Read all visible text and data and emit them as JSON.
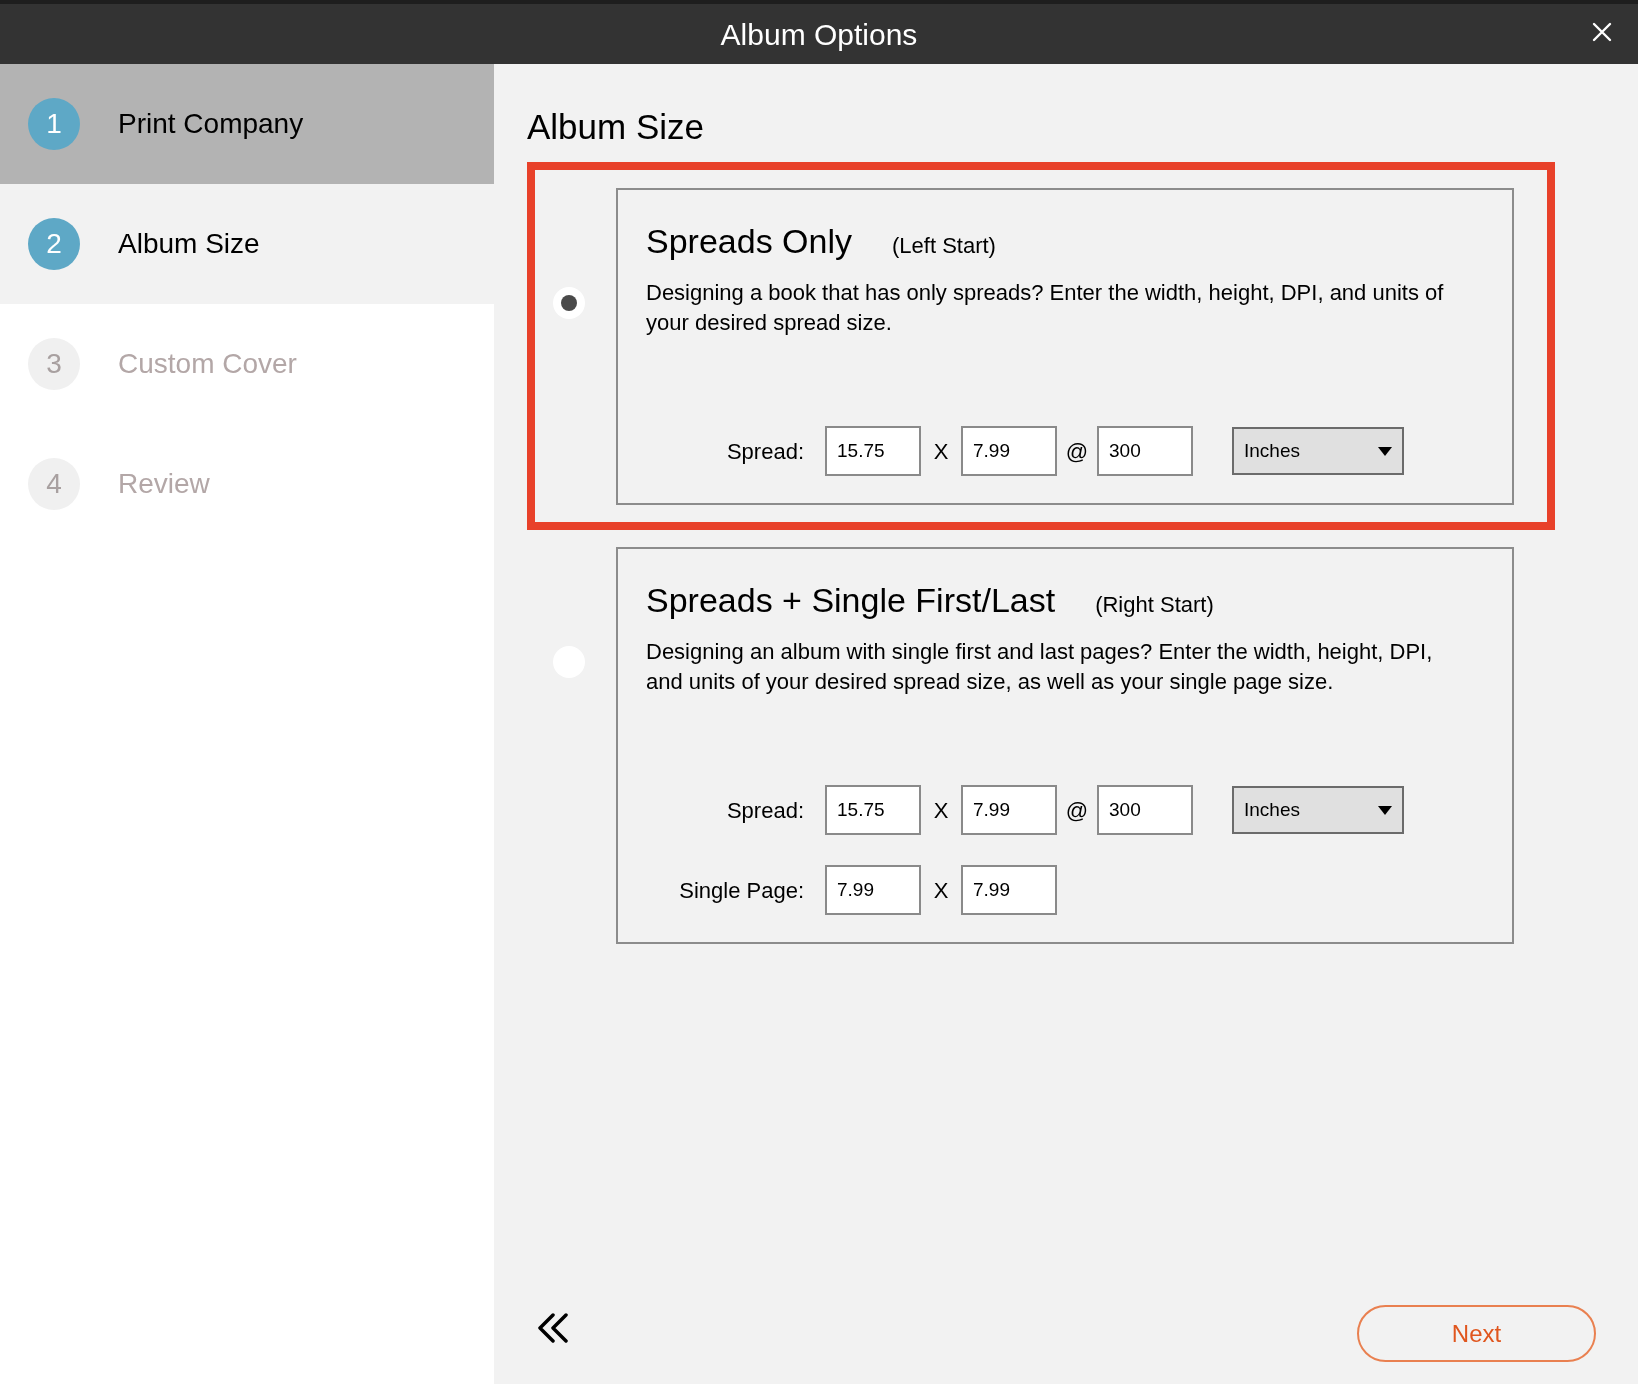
{
  "window": {
    "title": "Album Options"
  },
  "steps": [
    {
      "number": "1",
      "label": "Print Company",
      "completed": true,
      "selected": false,
      "disabled": false
    },
    {
      "number": "2",
      "label": "Album Size",
      "completed": false,
      "selected": true,
      "disabled": false
    },
    {
      "number": "3",
      "label": "Custom Cover",
      "completed": false,
      "selected": false,
      "disabled": true
    },
    {
      "number": "4",
      "label": "Review",
      "completed": false,
      "selected": false,
      "disabled": true
    }
  ],
  "heading": "Album Size",
  "options": [
    {
      "title": "Spreads Only",
      "subtitle": "(Left Start)",
      "selected": true,
      "description": "Designing a book that has only spreads? Enter the width, height, DPI, and units of your desired spread size.",
      "rows": [
        {
          "label": "Spread:",
          "items": [
            {
              "kind": "field",
              "value": "15.75"
            },
            {
              "kind": "sep",
              "text": "X"
            },
            {
              "kind": "field",
              "value": "7.99"
            },
            {
              "kind": "sep",
              "text": "@"
            },
            {
              "kind": "field",
              "value": "300"
            },
            {
              "kind": "select",
              "value": "Inches"
            }
          ]
        }
      ]
    },
    {
      "title": "Spreads + Single First/Last",
      "subtitle": "(Right Start)",
      "selected": false,
      "description": "Designing an album with single first and last pages? Enter the width, height, DPI, and units of your desired spread size, as well as your single page size.",
      "rows": [
        {
          "label": "Spread:",
          "items": [
            {
              "kind": "field",
              "value": "15.75"
            },
            {
              "kind": "sep",
              "text": "X"
            },
            {
              "kind": "field",
              "value": "7.99"
            },
            {
              "kind": "sep",
              "text": "@"
            },
            {
              "kind": "field",
              "value": "300"
            },
            {
              "kind": "select",
              "value": "Inches"
            }
          ]
        },
        {
          "label": "Single Page:",
          "items": [
            {
              "kind": "field",
              "value": "7.99"
            },
            {
              "kind": "sep",
              "text": "X"
            },
            {
              "kind": "field",
              "value": "7.99"
            }
          ]
        }
      ]
    }
  ],
  "buttons": {
    "next": "Next"
  }
}
